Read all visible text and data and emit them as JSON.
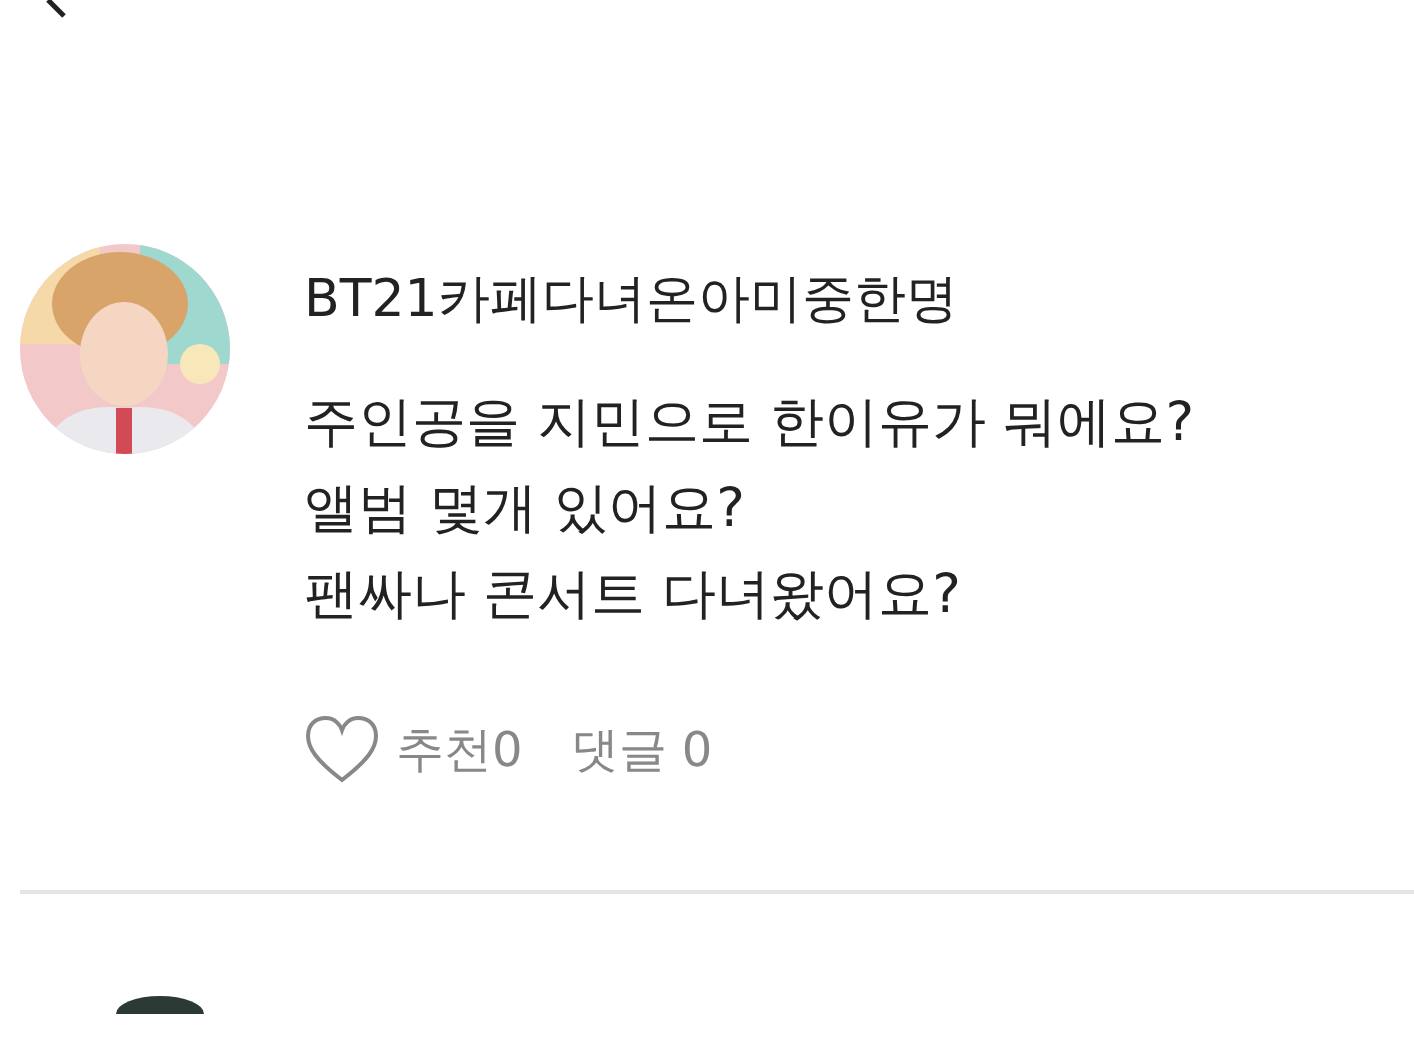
{
  "post": {
    "author": "BT21카페다녀온아미중한명",
    "lines": [
      "주인공을 지민으로 한이유가 뭐에요?",
      "앨범 몇개 있어요?",
      "팬싸나 콘서트 다녀왔어요?"
    ],
    "liked": false,
    "like_label": "추천",
    "like_count": "0",
    "comment_label": "댓글",
    "comment_count": "0"
  }
}
